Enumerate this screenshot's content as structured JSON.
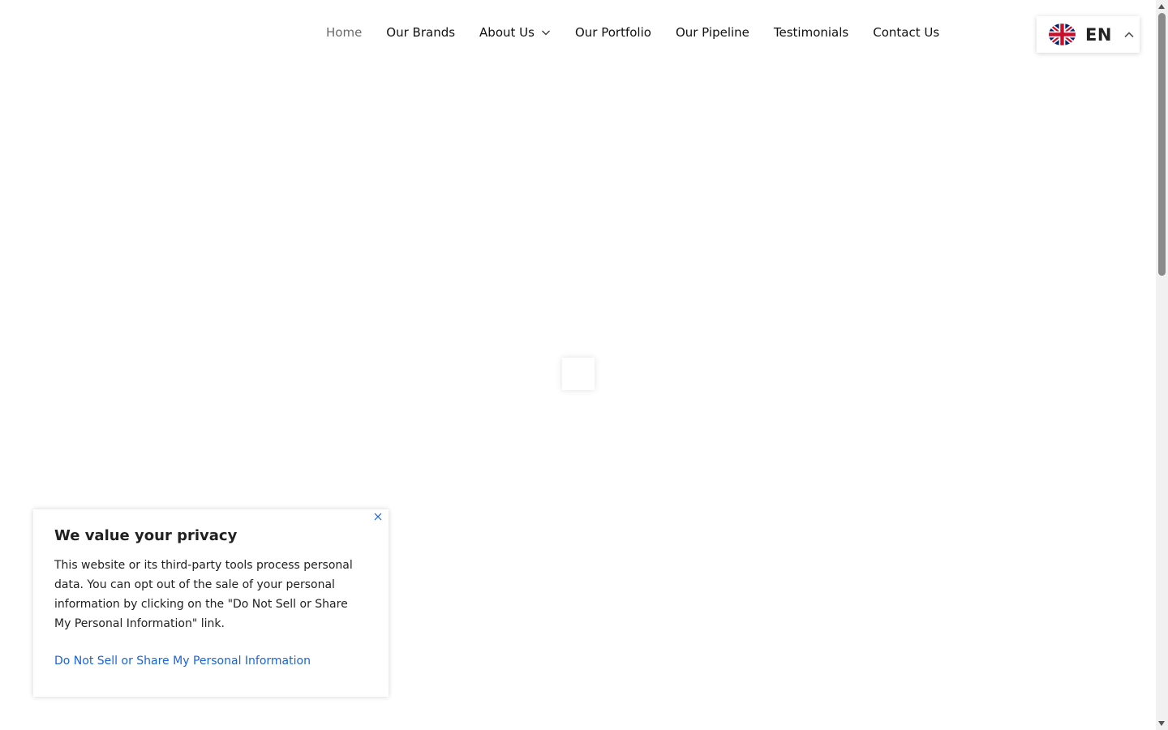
{
  "nav": {
    "items": [
      {
        "label": "Home",
        "active": true
      },
      {
        "label": "Our Brands"
      },
      {
        "label": "About Us",
        "has_dropdown": true
      },
      {
        "label": "Our Portfolio"
      },
      {
        "label": "Our Pipeline"
      },
      {
        "label": "Testimonials"
      },
      {
        "label": "Contact Us"
      }
    ]
  },
  "language": {
    "code": "EN",
    "flag_icon": "uk-flag-icon",
    "chevron_icon": "chevron-up-icon"
  },
  "privacy": {
    "title": "We value your privacy",
    "body": "This website or its third-party tools process personal data. You can opt out of the sale of your personal information by clicking on the \"Do Not Sell or Share My Personal Information\" link.",
    "link_label": "Do Not Sell or Share My Personal Information",
    "close_icon": "close-icon"
  },
  "colors": {
    "link": "#1863dc",
    "nav_text": "#111111",
    "nav_active": "#6b6b6b",
    "background": "#ffffff"
  }
}
